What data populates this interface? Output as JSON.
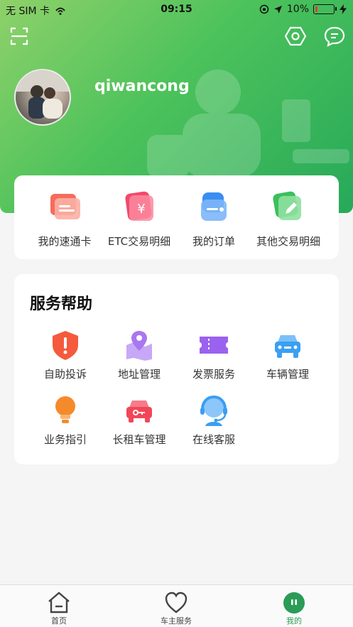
{
  "status_bar": {
    "carrier": "无 SIM 卡",
    "time": "09:15",
    "battery": "10%"
  },
  "header": {
    "username": "qiwancong",
    "scan_icon": "scan-icon",
    "settings_icon": "hexagon-settings-icon",
    "message_icon": "chat-bubble-icon"
  },
  "quick_actions": [
    {
      "label": "我的速通卡",
      "icon": "card-icon",
      "color": "#f56c5c"
    },
    {
      "label": "ETC交易明细",
      "icon": "yuan-icon",
      "color": "#f04a6b"
    },
    {
      "label": "我的订单",
      "icon": "wallet-icon",
      "color": "#3a8df2"
    },
    {
      "label": "其他交易明细",
      "icon": "edit-icon",
      "color": "#3bbf5c"
    }
  ],
  "services": {
    "title": "服务帮助",
    "items": [
      {
        "label": "自助投诉",
        "icon": "shield-alert-icon",
        "color": "#f55a3c"
      },
      {
        "label": "地址管理",
        "icon": "map-pin-icon",
        "color": "#a977f0"
      },
      {
        "label": "发票服务",
        "icon": "ticket-icon",
        "color": "#9a62ef"
      },
      {
        "label": "车辆管理",
        "icon": "car-icon",
        "color": "#3aa0f3"
      },
      {
        "label": "业务指引",
        "icon": "lightbulb-icon",
        "color": "#f58a2b"
      },
      {
        "label": "长租车管理",
        "icon": "rental-car-icon",
        "color": "#f24657"
      },
      {
        "label": "在线客服",
        "icon": "headset-icon",
        "color": "#3a9ef2"
      }
    ]
  },
  "tabbar": {
    "items": [
      {
        "label": "首页",
        "icon": "home-icon"
      },
      {
        "label": "车主服务",
        "icon": "heart-icon"
      },
      {
        "label": "我的",
        "icon": "profile-icon",
        "active": true
      }
    ],
    "active_color": "#2a9c57"
  }
}
